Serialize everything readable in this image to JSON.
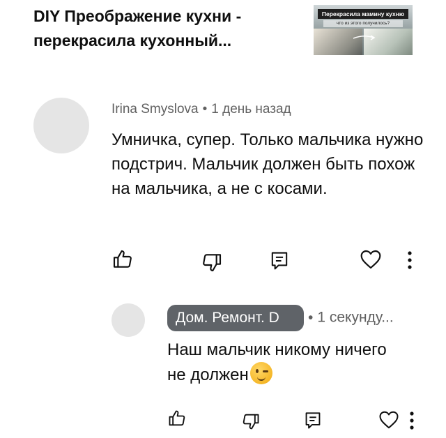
{
  "video": {
    "title": "DIY Преображение кухни - перекрасила кухонный...",
    "thumbnail": {
      "banner": "Перекрасила мамину кухню",
      "subtitle": "что из этого получилось?"
    }
  },
  "comment": {
    "author": "Irina Smyslova",
    "time": "1 день назад",
    "separator": "•",
    "text": "Умничка, супер. Только мальчика нужно подстрич. Мальчик должен быть похож на мальчика, а не с косами.",
    "actions": [
      "like-icon",
      "dislike-icon",
      "reply-icon",
      "heart-icon",
      "more-icon"
    ]
  },
  "reply": {
    "author": "Дом. Ремонт. D",
    "time": "1 секунду...",
    "separator": "•",
    "text": "Наш мальчик никому ничего не должен",
    "emoji": "winking-face",
    "actions": [
      "like-icon",
      "dislike-icon",
      "reply-icon",
      "heart-icon",
      "more-icon"
    ]
  },
  "colors": {
    "text": "#0f0f0f",
    "secondary": "#606060",
    "chip": "#5f6368",
    "avatar": "#e5e5e5"
  }
}
